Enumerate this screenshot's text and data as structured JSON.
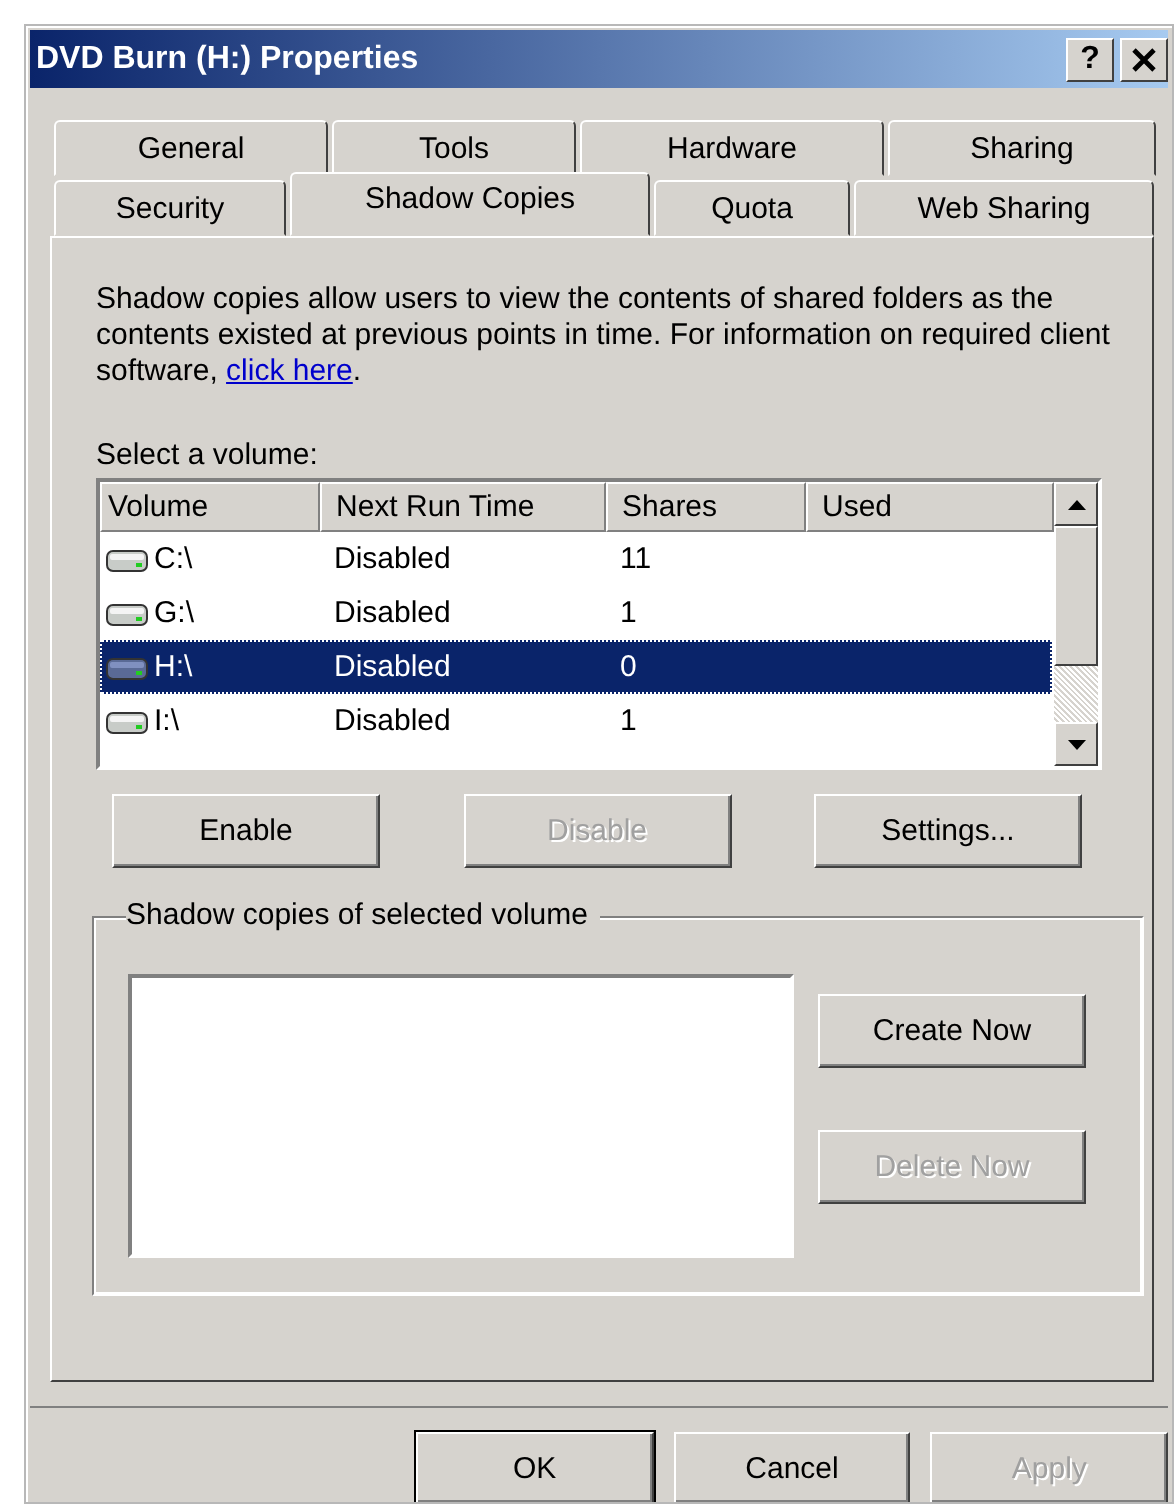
{
  "window": {
    "title": "DVD Burn (H:) Properties",
    "help_button": "?"
  },
  "tabs": [
    [
      {
        "label": "General",
        "selected": false
      },
      {
        "label": "Tools",
        "selected": false
      },
      {
        "label": "Hardware",
        "selected": false
      },
      {
        "label": "Sharing",
        "selected": false
      }
    ],
    [
      {
        "label": "Security",
        "selected": false
      },
      {
        "label": "Shadow Copies",
        "selected": true
      },
      {
        "label": "Quota",
        "selected": false
      },
      {
        "label": "Web Sharing",
        "selected": false
      }
    ]
  ],
  "description": {
    "text": "Shadow copies allow users to view the contents of shared folders as the contents existed at previous points in time. For information on required client software, ",
    "link": "click here",
    "after": "."
  },
  "volume_list": {
    "label": "Select a volume:",
    "columns": [
      "Volume",
      "Next Run Time",
      "Shares",
      "Used"
    ],
    "rows": [
      {
        "volume": "C:\\",
        "next_run_time": "Disabled",
        "shares": "11",
        "selected": false
      },
      {
        "volume": "G:\\",
        "next_run_time": "Disabled",
        "shares": "1",
        "selected": false
      },
      {
        "volume": "H:\\",
        "next_run_time": "Disabled",
        "shares": "0",
        "selected": true
      },
      {
        "volume": "I:\\",
        "next_run_time": "Disabled",
        "shares": "1",
        "selected": false
      }
    ]
  },
  "volume_buttons": [
    {
      "label": "Enable",
      "disabled": false
    },
    {
      "label": "Disable",
      "disabled": true
    },
    {
      "label": "Settings...",
      "disabled": false
    }
  ],
  "shadow_copies": {
    "title": "Shadow copies of selected volume",
    "buttons": [
      {
        "label": "Create Now",
        "disabled": false
      },
      {
        "label": "Delete Now",
        "disabled": true
      }
    ]
  },
  "dialog_buttons": [
    {
      "label": "OK",
      "disabled": false,
      "default": true
    },
    {
      "label": "Cancel",
      "disabled": false,
      "default": false
    },
    {
      "label": "Apply",
      "disabled": true,
      "default": false
    }
  ]
}
